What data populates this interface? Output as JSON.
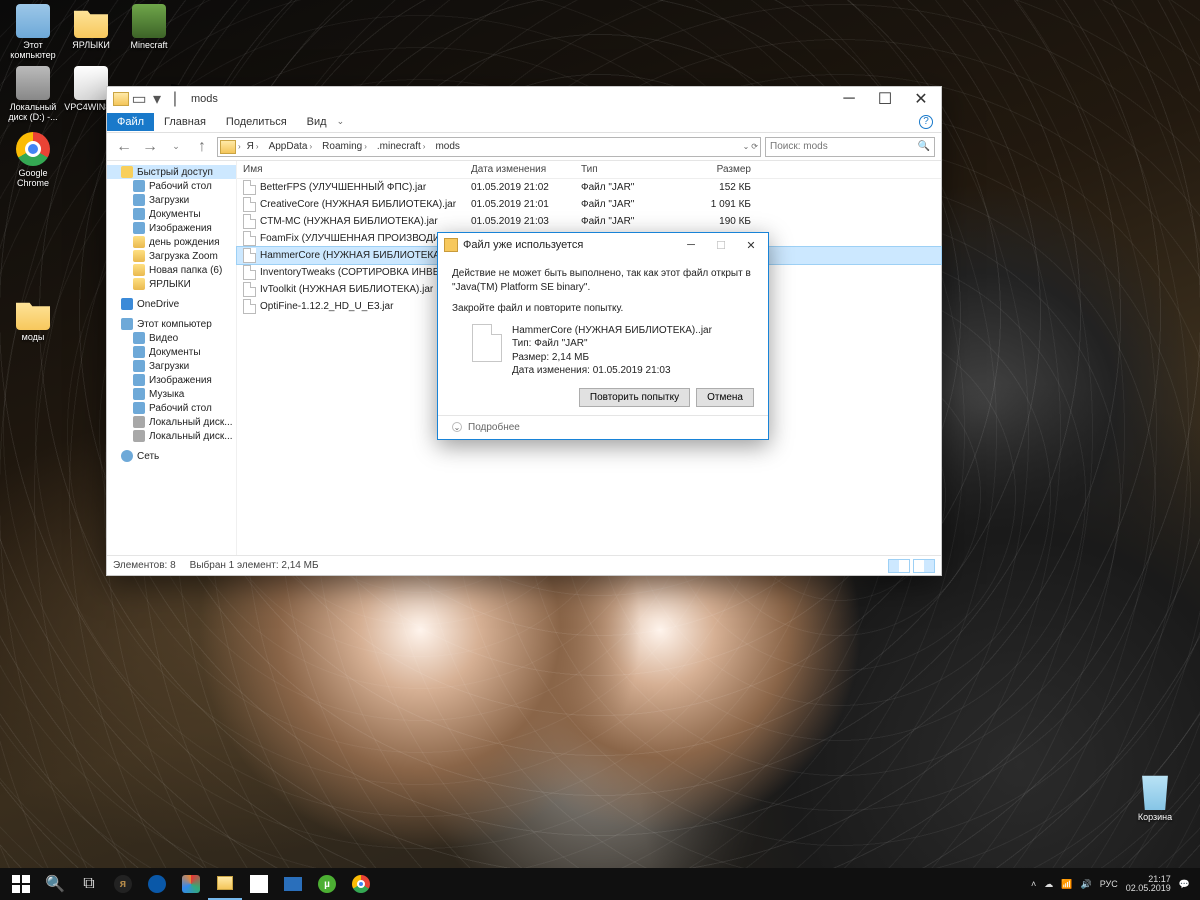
{
  "desktop": {
    "icons": [
      {
        "label": "Этот компьютер",
        "kind": "pc"
      },
      {
        "label": "ЯРЛЫКИ",
        "kind": "folder"
      },
      {
        "label": "Minecraft",
        "kind": "minecraft"
      },
      {
        "label": "Локальный диск (D:) -...",
        "kind": "disk"
      },
      {
        "label": "VPC4WIN8...",
        "kind": "app"
      },
      {
        "label": "Google Chrome",
        "kind": "chrome"
      },
      {
        "label": "моды",
        "kind": "folder"
      }
    ],
    "trash": "Корзина"
  },
  "explorer": {
    "title": "mods",
    "ribbon": {
      "file": "Файл",
      "tabs": [
        "Главная",
        "Поделиться",
        "Вид"
      ]
    },
    "nav": {
      "path": [
        "Я",
        "AppData",
        "Roaming",
        ".minecraft",
        "mods"
      ],
      "search_placeholder": "Поиск: mods"
    },
    "sidebar": {
      "quick": "Быстрый доступ",
      "quick_items": [
        "Рабочий стол",
        "Загрузки",
        "Документы",
        "Изображения",
        "день рождения",
        "Загрузка Zoom",
        "Новая папка (6)",
        "ЯРЛЫКИ"
      ],
      "onedrive": "OneDrive",
      "pc": "Этот компьютер",
      "pc_items": [
        "Видео",
        "Документы",
        "Загрузки",
        "Изображения",
        "Музыка",
        "Рабочий стол",
        "Локальный диск...",
        "Локальный диск..."
      ],
      "network": "Сеть"
    },
    "columns": {
      "name": "Имя",
      "date": "Дата изменения",
      "type": "Тип",
      "size": "Размер"
    },
    "files": [
      {
        "name": "BetterFPS (УЛУЧШЕННЫЙ ФПС).jar",
        "date": "01.05.2019 21:02",
        "type": "Файл \"JAR\"",
        "size": "152 КБ"
      },
      {
        "name": "CreativeCore (НУЖНАЯ БИБЛИОТЕКА).jar",
        "date": "01.05.2019 21:01",
        "type": "Файл \"JAR\"",
        "size": "1 091 КБ"
      },
      {
        "name": "CTM-MC (НУЖНАЯ БИБЛИОТЕКА).jar",
        "date": "01.05.2019 21:03",
        "type": "Файл \"JAR\"",
        "size": "190 КБ"
      },
      {
        "name": "FoamFix (УЛУЧШЕННАЯ ПРОИЗВОДИТ...",
        "date": "",
        "type": "",
        "size": ""
      },
      {
        "name": "HammerCore (НУЖНАЯ БИБЛИОТЕКА)....",
        "date": "",
        "type": "",
        "size": ""
      },
      {
        "name": "InventoryTweaks (СОРТИРОВКА ИНВЕНТ...",
        "date": "",
        "type": "",
        "size": ""
      },
      {
        "name": "IvToolkit (НУЖНАЯ БИБЛИОТЕКА).jar",
        "date": "",
        "type": "",
        "size": ""
      },
      {
        "name": "OptiFine-1.12.2_HD_U_E3.jar",
        "date": "",
        "type": "",
        "size": ""
      }
    ],
    "status": {
      "left": "Элементов: 8",
      "mid": "Выбран 1 элемент: 2,14 МБ"
    }
  },
  "dialog": {
    "title": "Файл уже используется",
    "line1": "Действие не может быть выполнено, так как этот файл открыт в \"Java(TM) Platform SE binary\".",
    "line2": "Закройте файл и повторите попытку.",
    "file_name": "HammerCore (НУЖНАЯ БИБЛИОТЕКА)..jar",
    "file_type": "Тип: Файл \"JAR\"",
    "file_size": "Размер: 2,14 МБ",
    "file_date": "Дата изменения: 01.05.2019 21:03",
    "retry": "Повторить попытку",
    "cancel": "Отмена",
    "more": "Подробнее"
  },
  "taskbar": {
    "tray": {
      "lang": "РУС",
      "time": "21:17",
      "date": "02.05.2019"
    }
  }
}
